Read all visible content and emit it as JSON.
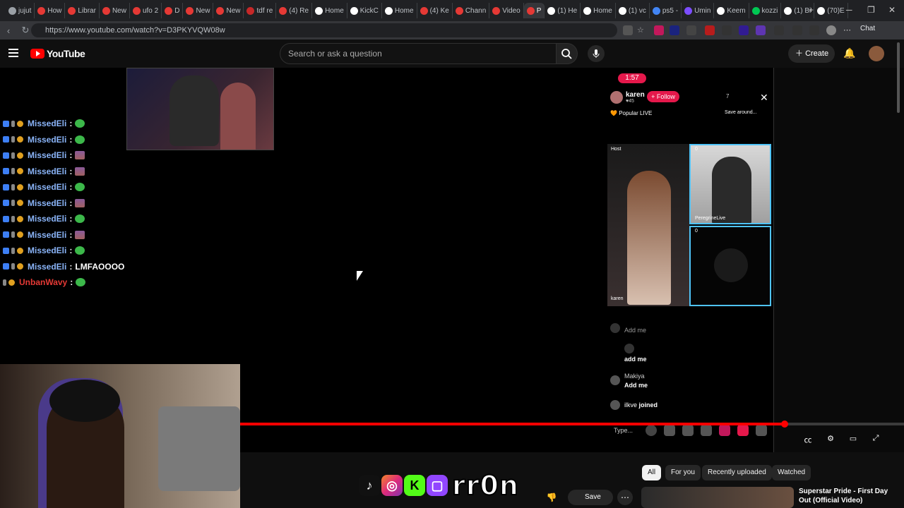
{
  "browser": {
    "tabs": [
      {
        "label": "jujut",
        "color": "#9aa0a6"
      },
      {
        "label": "How",
        "color": "#e53935"
      },
      {
        "label": "Librar",
        "color": "#e53935"
      },
      {
        "label": "New",
        "color": "#e53935"
      },
      {
        "label": "ufo 2",
        "color": "#e53935"
      },
      {
        "label": "D",
        "color": "#e53935"
      },
      {
        "label": "New",
        "color": "#e53935"
      },
      {
        "label": "New",
        "color": "#e53935"
      },
      {
        "label": "tdf re",
        "color": "#c62828"
      },
      {
        "label": "(4) Re",
        "color": "#e53935"
      },
      {
        "label": "Home",
        "color": "#ffffff"
      },
      {
        "label": "KickC",
        "color": "#ffffff"
      },
      {
        "label": "Home",
        "color": "#ffffff"
      },
      {
        "label": "(4) Ke",
        "color": "#e53935"
      },
      {
        "label": "Chann",
        "color": "#e53935"
      },
      {
        "label": "Video",
        "color": "#e53935"
      },
      {
        "label": "P",
        "color": "#e53935",
        "active": true
      },
      {
        "label": "(1) He",
        "color": "#ffffff"
      },
      {
        "label": "Home",
        "color": "#ffffff"
      },
      {
        "label": "(1) vc",
        "color": "#ffffff"
      },
      {
        "label": "ps5 -",
        "color": "#4285f4"
      },
      {
        "label": "Umin",
        "color": "#7c4dff"
      },
      {
        "label": "Keem",
        "color": "#ffffff"
      },
      {
        "label": "kozzi",
        "color": "#00c853"
      },
      {
        "label": "(1) Bi",
        "color": "#ffffff"
      },
      {
        "label": "(70)E",
        "color": "#ffffff"
      }
    ],
    "url": "https://www.youtube.com/watch?v=D3PKYVQW08w",
    "chat_label": "Chat",
    "new_tab": "+",
    "min": "─",
    "max": "❐",
    "close": "✕"
  },
  "youtube": {
    "logo_text": "YouTube",
    "search_placeholder": "Search or ask a question",
    "create_label": "Create",
    "chips": [
      "All",
      "For you",
      "Recently uploaded",
      "Watched"
    ],
    "save_label": "Save",
    "rec_title": "Superstar Pride - First Day Out (Official Video)"
  },
  "stream_chat": [
    {
      "user": "MissedEli",
      "emote": "green"
    },
    {
      "user": "MissedEli",
      "emote": "green"
    },
    {
      "user": "MissedEli",
      "emote": "pix"
    },
    {
      "user": "MissedEli",
      "emote": "pix"
    },
    {
      "user": "MissedEli",
      "emote": "green"
    },
    {
      "user": "MissedEli",
      "emote": "pix"
    },
    {
      "user": "MissedEli",
      "emote": "green"
    },
    {
      "user": "MissedEli",
      "emote": "pix"
    },
    {
      "user": "MissedEli",
      "emote": "green"
    },
    {
      "user": "MissedEli",
      "text": "LMFAOOOO"
    },
    {
      "user": "UnbanWavy",
      "emote": "green",
      "red": true
    }
  ],
  "tiktok": {
    "timer": "1:57",
    "host_name": "karen",
    "host_likes": "45",
    "follow_label": "+ Follow",
    "viewer_count": "7",
    "popular_label": "Popular LIVE",
    "save_label": "Save around...",
    "host_tag": "Host",
    "host_tile_name": "karen",
    "guest_name": "PeregrineLive",
    "guest_count": "0",
    "empty_count": "0",
    "comments": [
      {
        "user": "",
        "text": "Add me"
      },
      {
        "user": "",
        "text": "add me"
      },
      {
        "user": "Makiya",
        "text": "Add me"
      },
      {
        "user": "ilkve",
        "text": "joined"
      }
    ],
    "type_placeholder": "Type..."
  },
  "player": {
    "progress": 0.82
  },
  "overlay_logo": "rr0n"
}
